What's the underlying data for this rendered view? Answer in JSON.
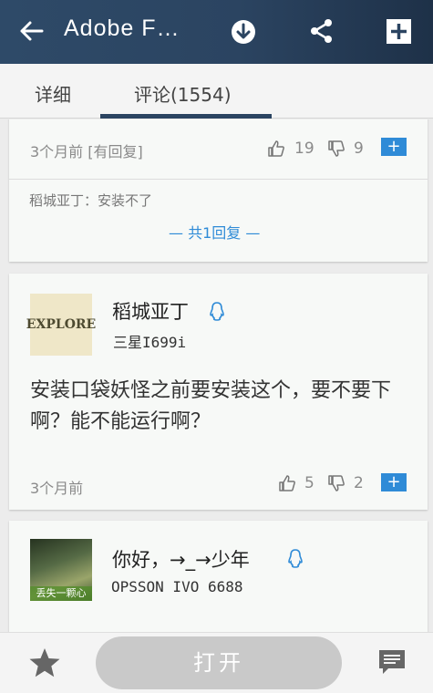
{
  "header": {
    "title": "Adobe F…",
    "colors": {
      "bar": "#2b4461",
      "accent": "#2f8bd7"
    },
    "icons": [
      "back-arrow-icon",
      "download-icon",
      "share-icon",
      "add-icon"
    ]
  },
  "tabs": [
    {
      "label": "详细",
      "active": false
    },
    {
      "label": "评论(1554)",
      "active": true
    }
  ],
  "comments": [
    {
      "time": "3个月前 [有回复]",
      "likes": "19",
      "dislikes": "9",
      "add_label": "+",
      "reply_preview": "稻城亚丁：安装不了",
      "reply_count": "— 共1回复 —"
    },
    {
      "user": "稻城亚丁",
      "device": "三星I699i",
      "avatar_text": "EXPLORE",
      "text": "安装口袋妖怪之前要安装这个，要不要下啊？能不能运行啊？",
      "time": "3个月前",
      "likes": "5",
      "dislikes": "2",
      "add_label": "+"
    },
    {
      "user": "你好，→_→少年",
      "device": "OPSSON IVO 6688",
      "avatar_caption": "丢失一颗心"
    }
  ],
  "bottom": {
    "open_label": "打开",
    "icons": [
      "star-icon",
      "comment-icon"
    ]
  }
}
